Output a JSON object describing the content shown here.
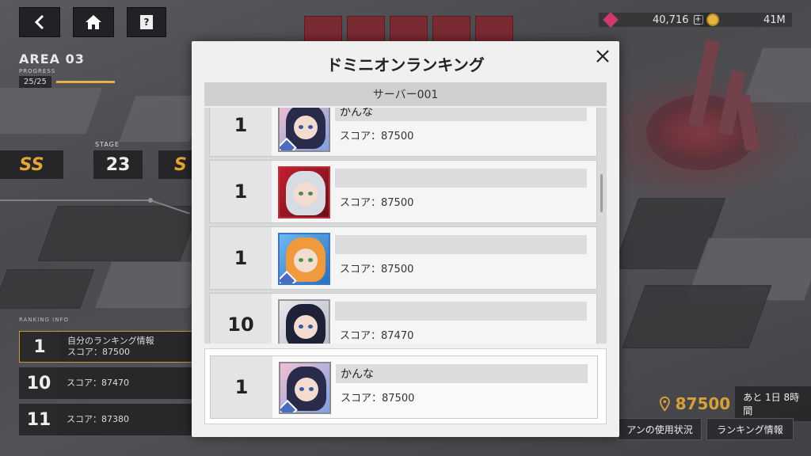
{
  "nav": {
    "back_icon": "chevron-left-icon",
    "home_icon": "home-icon",
    "help_label": "?"
  },
  "area": {
    "title": "AREA 03",
    "progress_label": "PROGRESS",
    "progress_value": "25/25",
    "progress_fraction": 1.0
  },
  "stage": {
    "label": "STAGE",
    "number": "23",
    "rank_left": "SS",
    "rank_right": "S"
  },
  "ranking_info": {
    "label": "RANKING INFO",
    "rows": [
      {
        "rank": "1",
        "line1": "自分のランキング情報",
        "line2": "スコア：87500"
      },
      {
        "rank": "10",
        "line1": "",
        "line2": "スコア：87470"
      },
      {
        "rank": "11",
        "line1": "",
        "line2": "スコア：87380"
      }
    ]
  },
  "currency": {
    "gems": "40,716",
    "gems_plus": "+",
    "coins": "41M"
  },
  "bottom": {
    "score": "87500",
    "remaining": "あと 1日 8時間",
    "usage_button": "アンの使用状況",
    "ranking_button": "ランキング情報"
  },
  "modal": {
    "title": "ドミニオンランキング",
    "server": "サーバー001",
    "entries": [
      {
        "rank": "1",
        "name": "かんな",
        "score": "スコア：87500"
      },
      {
        "rank": "1",
        "name": "",
        "score": "スコア：87500"
      },
      {
        "rank": "1",
        "name": "",
        "score": "スコア：87500"
      },
      {
        "rank": "10",
        "name": "",
        "score": "スコア：87470"
      }
    ],
    "my_entry": {
      "rank": "1",
      "name": "かんな",
      "score": "スコア：87500"
    }
  },
  "colors": {
    "accent_gold": "#d6a136",
    "modal_bg": "#f0f0f1",
    "scene_red": "#b95e6a"
  }
}
